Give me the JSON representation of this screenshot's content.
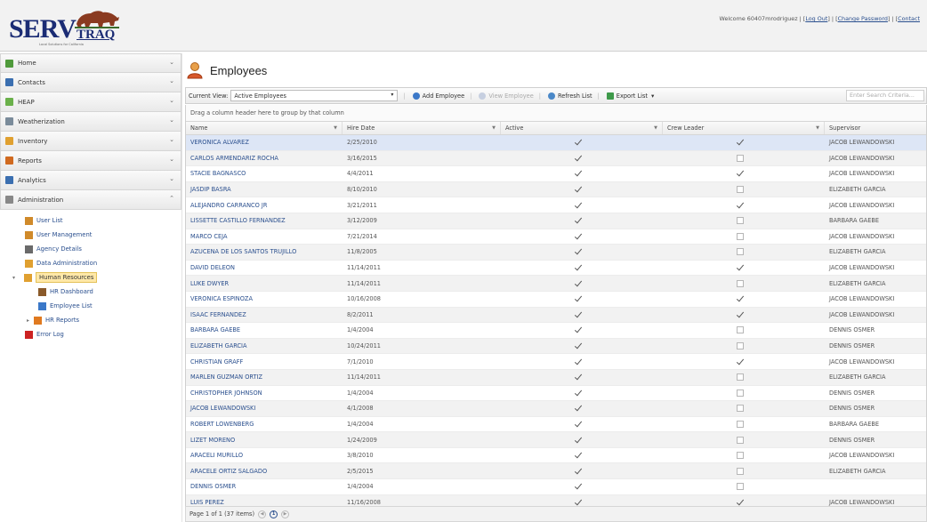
{
  "app": {
    "logo_text": "SERV",
    "logo_sub": "TRAQ",
    "logo_tagline": "Local Solutions for California"
  },
  "header": {
    "welcome": "Welcome 60407mrodriguez",
    "logout": "Log Out",
    "change_password": "Change Password",
    "contact": "Contact"
  },
  "sidebar": {
    "items": [
      {
        "label": "Home",
        "icon": "house-icon",
        "color": "#4f9a3b"
      },
      {
        "label": "Contacts",
        "icon": "contacts-icon",
        "color": "#3b6fb0"
      },
      {
        "label": "HEAP",
        "icon": "heap-icon",
        "color": "#6ab04a"
      },
      {
        "label": "Weatherization",
        "icon": "weather-icon",
        "color": "#7a8b9a"
      },
      {
        "label": "Inventory",
        "icon": "box-icon",
        "color": "#e0a030"
      },
      {
        "label": "Reports",
        "icon": "reports-icon",
        "color": "#d06a20"
      },
      {
        "label": "Analytics",
        "icon": "analytics-icon",
        "color": "#3b6fb0"
      },
      {
        "label": "Administration",
        "icon": "admin-icon",
        "color": "#888888"
      }
    ],
    "admin_children": [
      {
        "label": "User List"
      },
      {
        "label": "User Management"
      },
      {
        "label": "Agency Details"
      },
      {
        "label": "Data Administration"
      },
      {
        "label": "Human Resources"
      },
      {
        "label": "HR Dashboard"
      },
      {
        "label": "Employee List"
      },
      {
        "label": "HR Reports"
      },
      {
        "label": "Error Log"
      }
    ]
  },
  "main": {
    "title": "Employees",
    "toolbar": {
      "current_view_label": "Current View:",
      "current_view_value": "Active Employees",
      "add_employee": "Add Employee",
      "view_employee": "View Employee",
      "refresh_list": "Refresh List",
      "export_list": "Export List",
      "search_placeholder": "Enter Search Criteria..."
    },
    "group_hint": "Drag a column header here to group by that column",
    "columns": [
      "Name",
      "Hire Date",
      "Active",
      "Crew Leader",
      "Supervisor"
    ],
    "rows": [
      {
        "name": "VERONICA ALVAREZ",
        "hire": "2/25/2010",
        "active": true,
        "crew": true,
        "sup": "JACOB LEWANDOWSKI"
      },
      {
        "name": "CARLOS ARMENDARIZ ROCHA",
        "hire": "3/16/2015",
        "active": true,
        "crew": false,
        "sup": "JACOB LEWANDOWSKI"
      },
      {
        "name": "STACIE BAGNASCO",
        "hire": "4/4/2011",
        "active": true,
        "crew": true,
        "sup": "JACOB LEWANDOWSKI"
      },
      {
        "name": "JASDIP BASRA",
        "hire": "8/10/2010",
        "active": true,
        "crew": false,
        "sup": "ELIZABETH GARCIA"
      },
      {
        "name": "ALEJANDRO CARRANCO JR",
        "hire": "3/21/2011",
        "active": true,
        "crew": true,
        "sup": "JACOB LEWANDOWSKI"
      },
      {
        "name": "LISSETTE CASTILLO FERNANDEZ",
        "hire": "3/12/2009",
        "active": true,
        "crew": false,
        "sup": "BARBARA GAEBE"
      },
      {
        "name": "MARCO CEJA",
        "hire": "7/21/2014",
        "active": true,
        "crew": false,
        "sup": "JACOB LEWANDOWSKI"
      },
      {
        "name": "AZUCENA DE LOS SANTOS TRUJILLO",
        "hire": "11/8/2005",
        "active": true,
        "crew": false,
        "sup": "ELIZABETH GARCIA"
      },
      {
        "name": "DAVID DELEON",
        "hire": "11/14/2011",
        "active": true,
        "crew": true,
        "sup": "JACOB LEWANDOWSKI"
      },
      {
        "name": "LUKE DWYER",
        "hire": "11/14/2011",
        "active": true,
        "crew": false,
        "sup": "ELIZABETH GARCIA"
      },
      {
        "name": "VERONICA ESPINOZA",
        "hire": "10/16/2008",
        "active": true,
        "crew": true,
        "sup": "JACOB LEWANDOWSKI"
      },
      {
        "name": "ISAAC FERNANDEZ",
        "hire": "8/2/2011",
        "active": true,
        "crew": true,
        "sup": "JACOB LEWANDOWSKI"
      },
      {
        "name": "BARBARA GAEBE",
        "hire": "1/4/2004",
        "active": true,
        "crew": false,
        "sup": "DENNIS OSMER"
      },
      {
        "name": "ELIZABETH GARCIA",
        "hire": "10/24/2011",
        "active": true,
        "crew": false,
        "sup": "DENNIS OSMER"
      },
      {
        "name": "CHRISTIAN GRAFF",
        "hire": "7/1/2010",
        "active": true,
        "crew": true,
        "sup": "JACOB LEWANDOWSKI"
      },
      {
        "name": "MARLEN GUZMAN ORTIZ",
        "hire": "11/14/2011",
        "active": true,
        "crew": false,
        "sup": "ELIZABETH GARCIA"
      },
      {
        "name": "CHRISTOPHER JOHNSON",
        "hire": "1/4/2004",
        "active": true,
        "crew": false,
        "sup": "DENNIS OSMER"
      },
      {
        "name": "JACOB LEWANDOWSKI",
        "hire": "4/1/2008",
        "active": true,
        "crew": false,
        "sup": "DENNIS OSMER"
      },
      {
        "name": "ROBERT LOWENBERG",
        "hire": "1/4/2004",
        "active": true,
        "crew": false,
        "sup": "BARBARA GAEBE"
      },
      {
        "name": "LIZET MORENO",
        "hire": "1/24/2009",
        "active": true,
        "crew": false,
        "sup": "DENNIS OSMER"
      },
      {
        "name": "ARACELI MURILLO",
        "hire": "3/8/2010",
        "active": true,
        "crew": false,
        "sup": "JACOB LEWANDOWSKI"
      },
      {
        "name": "ARACELE ORTIZ SALGADO",
        "hire": "2/5/2015",
        "active": true,
        "crew": false,
        "sup": "ELIZABETH GARCIA"
      },
      {
        "name": "DENNIS OSMER",
        "hire": "1/4/2004",
        "active": true,
        "crew": false,
        "sup": ""
      },
      {
        "name": "LUIS PEREZ",
        "hire": "11/16/2008",
        "active": true,
        "crew": true,
        "sup": "JACOB LEWANDOWSKI"
      }
    ],
    "pager": {
      "text": "Page 1 of 1 (37 items)",
      "current_page": "1"
    }
  }
}
